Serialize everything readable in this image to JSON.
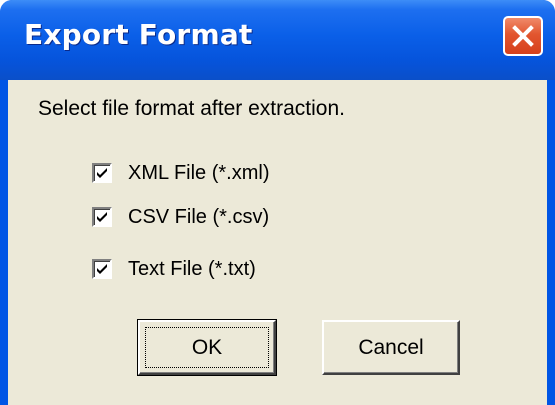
{
  "window": {
    "title": "Export Format"
  },
  "dialog": {
    "prompt": "Select file format after extraction.",
    "options": [
      {
        "label": "XML File (*.xml)",
        "checked": true
      },
      {
        "label": "CSV File (*.csv)",
        "checked": true
      },
      {
        "label": "Text File (*.txt)",
        "checked": true
      }
    ]
  },
  "buttons": {
    "ok_label": "OK",
    "cancel_label": "Cancel"
  },
  "colors": {
    "titlebar": "#0a5fe8",
    "client_background": "#ece9d8",
    "close_button": "#e2562f"
  },
  "icons": {
    "close": "close-icon",
    "check": "checkmark-icon"
  }
}
